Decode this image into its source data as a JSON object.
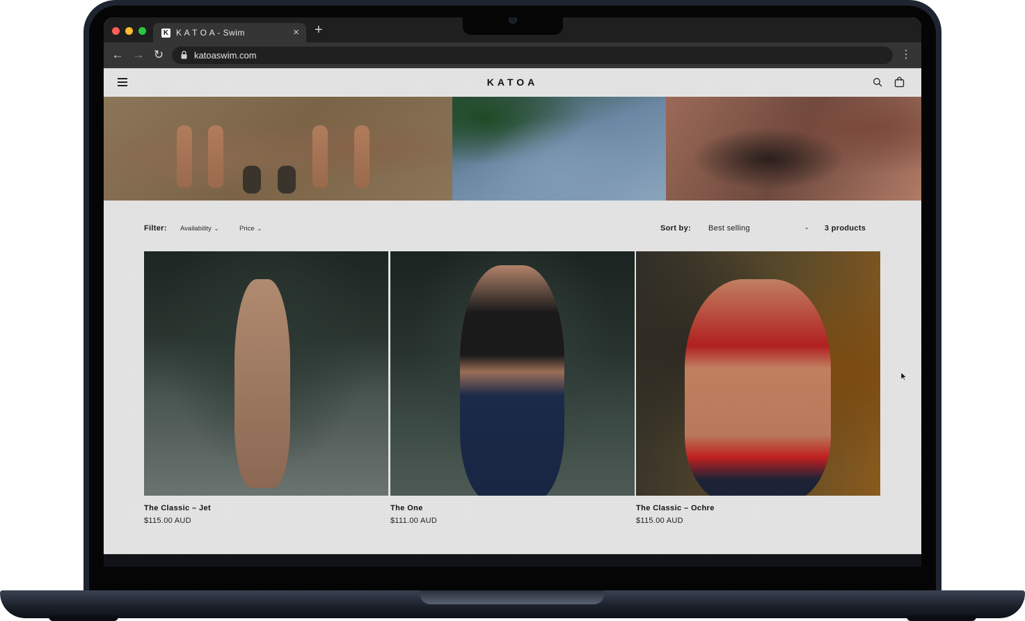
{
  "browser": {
    "tab_title": "K A T O A - Swim",
    "tab_favicon": "K",
    "url": "katoaswim.com",
    "icons": {
      "back": "arrow-left-icon",
      "forward": "arrow-right-icon",
      "reload": "reload-icon",
      "lock": "lock-icon",
      "menu": "kebab-menu-icon",
      "new_tab": "plus-icon",
      "close_tab": "close-icon"
    }
  },
  "site": {
    "logo": "KATOA",
    "header_icons": [
      "hamburger-menu-icon",
      "search-icon",
      "cart-icon"
    ],
    "filter": {
      "label": "Filter:",
      "availability": "Availability",
      "price": "Price"
    },
    "sort": {
      "label": "Sort by:",
      "selected": "Best selling"
    },
    "product_count": "3 products",
    "products": [
      {
        "title": "The Classic – Jet",
        "price": "$115.00 AUD"
      },
      {
        "title": "The One",
        "price": "$111.00 AUD"
      },
      {
        "title": "The Classic – Ochre",
        "price": "$115.00 AUD"
      }
    ]
  },
  "colors": {
    "site_background": "#e6e6e6",
    "browser_chrome": "#353535",
    "text": "#111111"
  }
}
